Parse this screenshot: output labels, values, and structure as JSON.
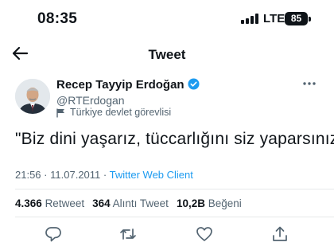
{
  "status_bar": {
    "time": "08:35",
    "network": "LTE",
    "battery": "85"
  },
  "nav": {
    "title": "Tweet",
    "back_icon": "arrow-left-icon"
  },
  "author": {
    "name": "Recep Tayyip Erdoğan",
    "handle": "@RTErdogan",
    "label": "Türkiye devlet görevlisi",
    "verified": true,
    "accent": "#1d9bf0"
  },
  "tweet": {
    "text": "\"Biz dini yaşarız, tüccarlığını siz yaparsınız.\"",
    "time": "21:56",
    "date": "11.07.2011",
    "separator": "·",
    "source": "Twitter Web Client"
  },
  "stats": {
    "retweets_count": "4.366",
    "retweets_label": "Retweet",
    "quotes_count": "364",
    "quotes_label": "Alıntı Tweet",
    "likes_count": "10,2B",
    "likes_label": "Beğeni"
  },
  "actions": [
    "reply-icon",
    "retweet-icon",
    "like-icon",
    "share-icon"
  ]
}
